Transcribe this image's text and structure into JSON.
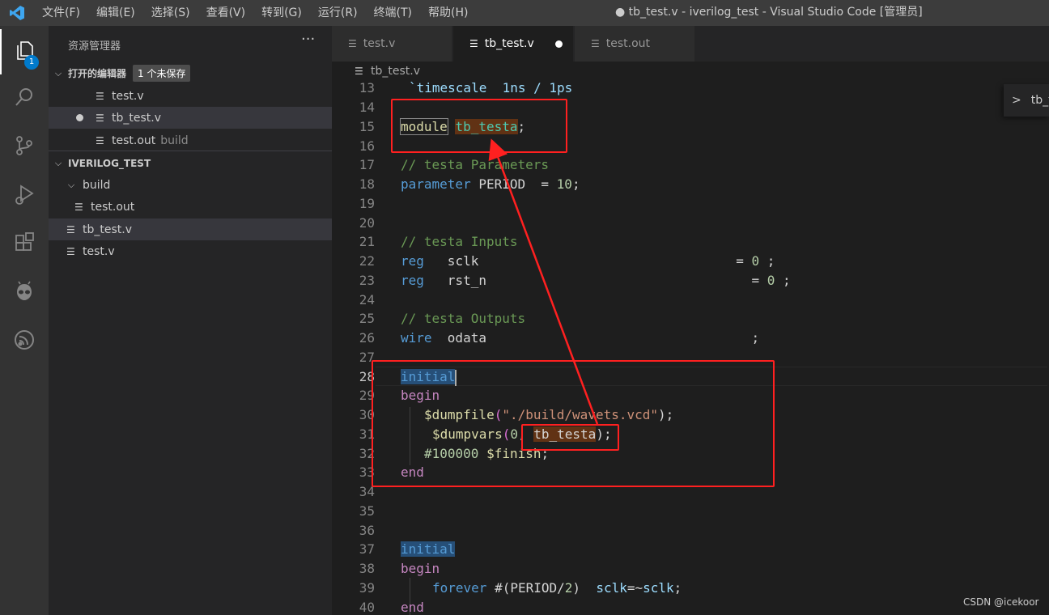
{
  "window": {
    "title": "● tb_test.v - iverilog_test - Visual Studio Code [管理员]",
    "menu": [
      "文件(F)",
      "编辑(E)",
      "选择(S)",
      "查看(V)",
      "转到(G)",
      "运行(R)",
      "终端(T)",
      "帮助(H)"
    ]
  },
  "activity_bar": {
    "explorer_badge": "1",
    "items": [
      "files-icon",
      "search-icon",
      "source-control-icon",
      "run-debug-icon",
      "extensions-icon",
      "platformio-alien-icon",
      "espressif-icon"
    ]
  },
  "sidebar": {
    "title": "资源管理器",
    "more": "···",
    "open_editors": {
      "header": "打开的编辑器",
      "unsaved_badge": "1 个未保存",
      "items": [
        {
          "name": "test.v",
          "desc": ""
        },
        {
          "name": "tb_test.v",
          "desc": ""
        },
        {
          "name": "test.out",
          "desc": "build"
        }
      ]
    },
    "workspace": {
      "header": "IVERILOG_TEST",
      "folder": "build",
      "folder_child": "test.out",
      "files": [
        "tb_test.v",
        "test.v"
      ]
    }
  },
  "tabs": [
    {
      "label": "test.v"
    },
    {
      "label": "tb_test.v"
    },
    {
      "label": "test.out"
    }
  ],
  "breadcrumb": "tb_test.v",
  "peek_label": "tb_t",
  "editor": {
    "line_numbers": [
      "13",
      "14",
      "15",
      "16",
      "17",
      "18",
      "19",
      "20",
      "21",
      "22",
      "23",
      "24",
      "25",
      "26",
      "27",
      "28",
      "29",
      "30",
      "31",
      "32",
      "33",
      "34",
      "35",
      "36",
      "37",
      "38",
      "39",
      "40"
    ],
    "code": {
      "l13": "`timescale  1ns / 1ps",
      "l15_kw": "module",
      "l15_name": "tb_testa",
      "l15_end": ";",
      "l17": "// testa Parameters",
      "l18_kw": "parameter",
      "l18_id": " PERIOD  = ",
      "l18_num": "10",
      "l18_end": ";",
      "l21": "// testa Inputs",
      "l22_kw": "reg",
      "l22_id": "   sclk                                 = ",
      "l22_num": "0",
      "l22_end": " ;",
      "l23_kw": "reg",
      "l23_id": "   rst_n                                  = ",
      "l23_num": "0",
      "l23_end": " ;",
      "l25": "// testa Outputs",
      "l26_kw": "wire",
      "l26_id": "  odata                                  ;",
      "l28_kw": "initial",
      "l29_kw": "begin",
      "l30_fn": "$dumpfile",
      "l30_open": "(",
      "l30_str": "\"./build/wavets.vcd\"",
      "l30_close": ");",
      "l31_fn": "$dumpvars",
      "l31_open": "(",
      "l31_num": "0",
      "l31_sep": ", ",
      "l31_name": "tb_testa",
      "l31_close": ");",
      "l32_num": "#100000",
      "l32_fn": " $finish",
      "l32_end": ";",
      "l33_kw": "end",
      "l37_kw": "initial",
      "l38_kw": "begin",
      "l39_kw": "forever",
      "l39_a": " #(PERIOD/",
      "l39_num": "2",
      "l39_b": ")  ",
      "l39_id": "sclk",
      "l39_c": "=~",
      "l39_id2": "sclk",
      "l39_end": ";",
      "l40_kw": "end"
    }
  },
  "watermark": "CSDN @icekoor",
  "colors": {
    "accent": "#007acc",
    "annotation": "#ff2020"
  }
}
